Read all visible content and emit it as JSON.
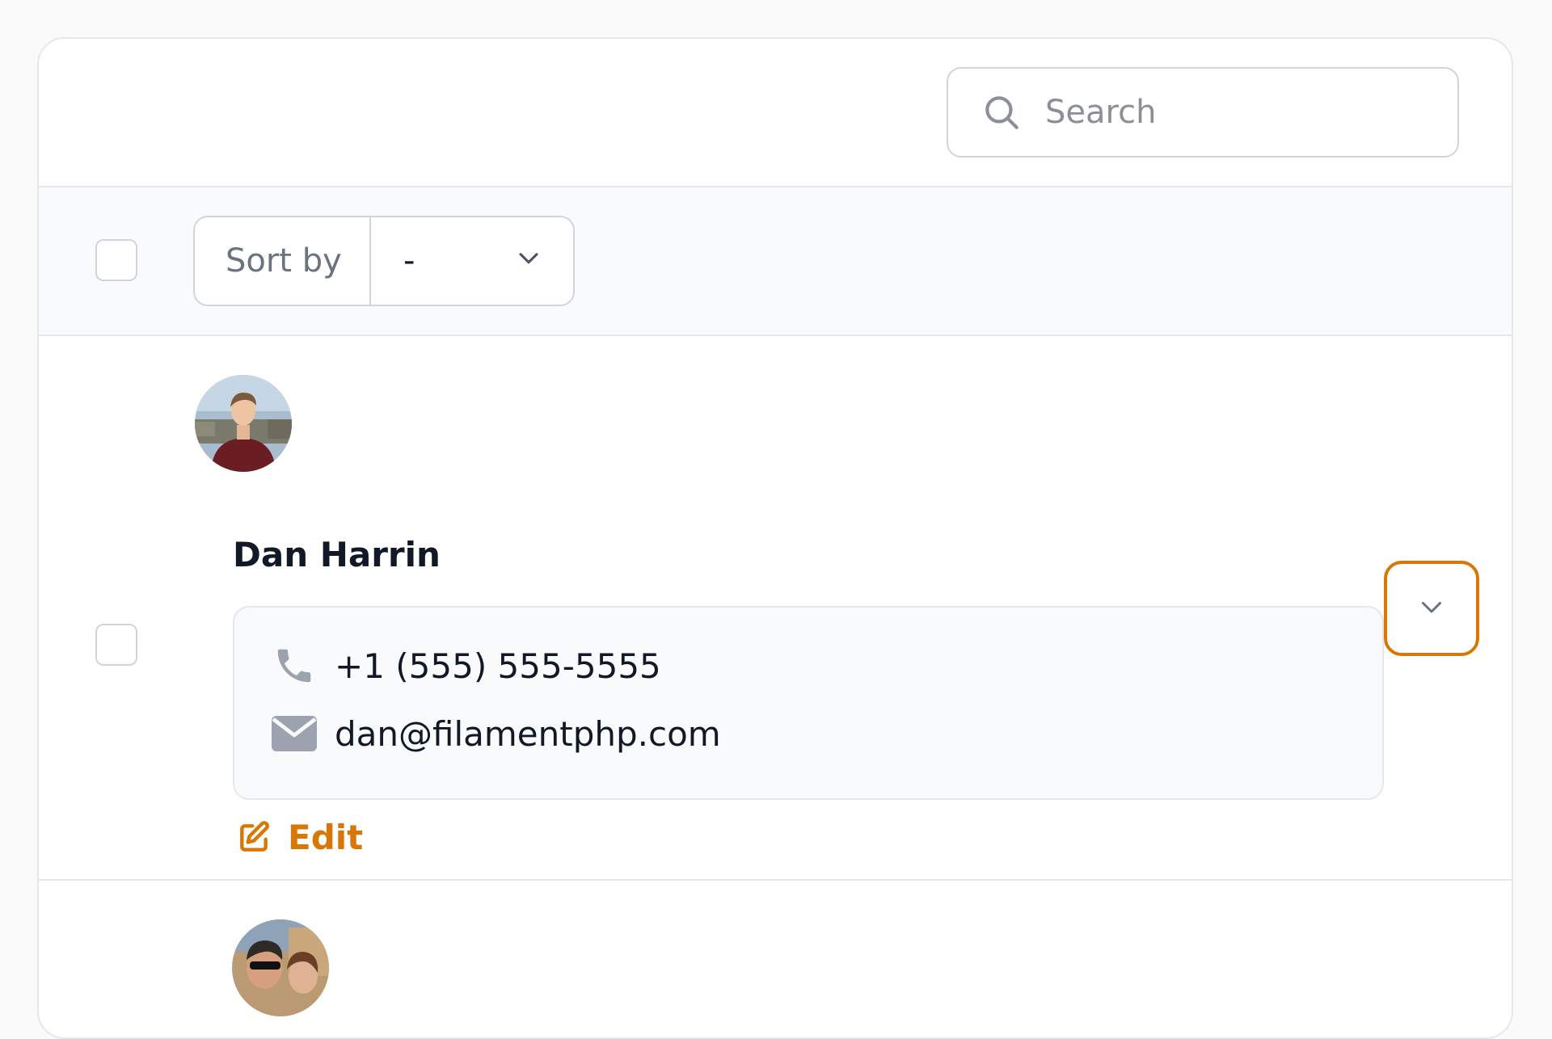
{
  "search": {
    "placeholder": "Search",
    "value": ""
  },
  "toolbar": {
    "sort_label": "Sort by",
    "sort_value": "-"
  },
  "records": [
    {
      "name": "Dan Harrin",
      "phone": "+1 (555) 555-5555",
      "email": "dan@filamentphp.com",
      "edit_label": "Edit"
    }
  ],
  "icons": {
    "search": "search-icon",
    "phone": "phone-icon",
    "email": "envelope-icon",
    "edit": "pencil-square-icon",
    "expand": "chevron-down-icon"
  },
  "colors": {
    "accent": "#d97706",
    "border": "#e5e7eb",
    "muted_text": "#6b7280",
    "icon_gray": "#9ca3af"
  }
}
